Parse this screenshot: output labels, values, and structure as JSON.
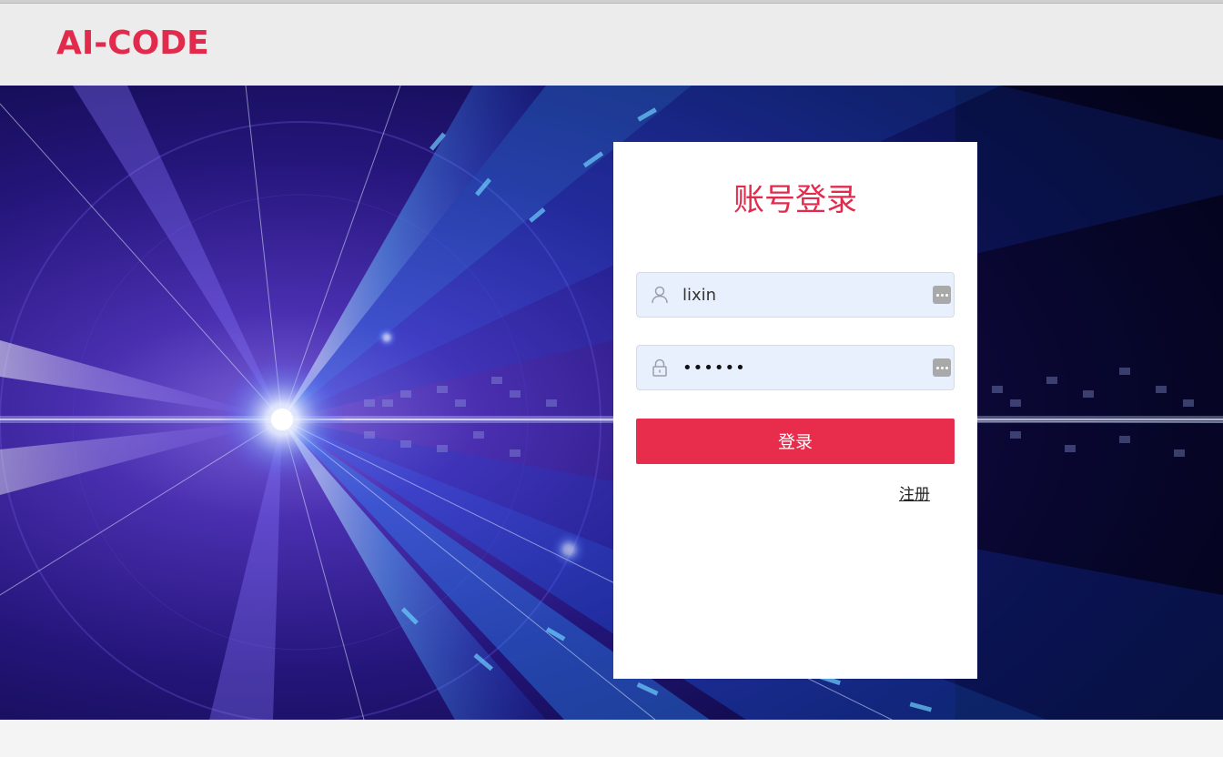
{
  "header": {
    "logo_text": "AI-CODE"
  },
  "login": {
    "title": "账号登录",
    "username_value": "lixin",
    "password_value": "••••••",
    "submit_label": "登录",
    "register_label": "注册"
  },
  "icons": {
    "user": "user-icon",
    "lock": "lock-icon",
    "credential": "credential-autofill-icon"
  },
  "colors": {
    "brand": "#e22b4c",
    "button": "#e82d4c",
    "input_bg": "#e8f0fe"
  }
}
